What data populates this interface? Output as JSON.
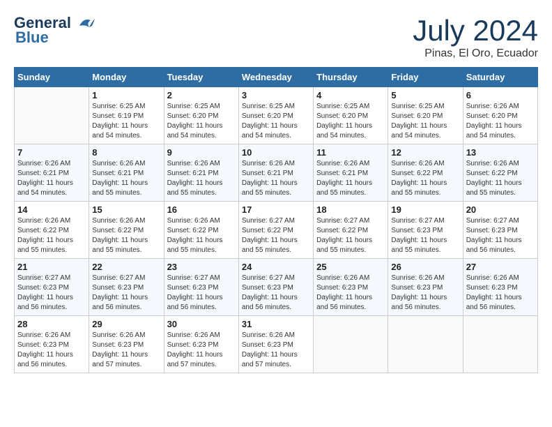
{
  "header": {
    "logo_line1": "General",
    "logo_line2": "Blue",
    "month": "July 2024",
    "location": "Pinas, El Oro, Ecuador"
  },
  "weekdays": [
    "Sunday",
    "Monday",
    "Tuesday",
    "Wednesday",
    "Thursday",
    "Friday",
    "Saturday"
  ],
  "weeks": [
    [
      {
        "day": "",
        "info": ""
      },
      {
        "day": "1",
        "info": "Sunrise: 6:25 AM\nSunset: 6:19 PM\nDaylight: 11 hours\nand 54 minutes."
      },
      {
        "day": "2",
        "info": "Sunrise: 6:25 AM\nSunset: 6:20 PM\nDaylight: 11 hours\nand 54 minutes."
      },
      {
        "day": "3",
        "info": "Sunrise: 6:25 AM\nSunset: 6:20 PM\nDaylight: 11 hours\nand 54 minutes."
      },
      {
        "day": "4",
        "info": "Sunrise: 6:25 AM\nSunset: 6:20 PM\nDaylight: 11 hours\nand 54 minutes."
      },
      {
        "day": "5",
        "info": "Sunrise: 6:25 AM\nSunset: 6:20 PM\nDaylight: 11 hours\nand 54 minutes."
      },
      {
        "day": "6",
        "info": "Sunrise: 6:26 AM\nSunset: 6:20 PM\nDaylight: 11 hours\nand 54 minutes."
      }
    ],
    [
      {
        "day": "7",
        "info": "Sunrise: 6:26 AM\nSunset: 6:21 PM\nDaylight: 11 hours\nand 54 minutes."
      },
      {
        "day": "8",
        "info": "Sunrise: 6:26 AM\nSunset: 6:21 PM\nDaylight: 11 hours\nand 55 minutes."
      },
      {
        "day": "9",
        "info": "Sunrise: 6:26 AM\nSunset: 6:21 PM\nDaylight: 11 hours\nand 55 minutes."
      },
      {
        "day": "10",
        "info": "Sunrise: 6:26 AM\nSunset: 6:21 PM\nDaylight: 11 hours\nand 55 minutes."
      },
      {
        "day": "11",
        "info": "Sunrise: 6:26 AM\nSunset: 6:21 PM\nDaylight: 11 hours\nand 55 minutes."
      },
      {
        "day": "12",
        "info": "Sunrise: 6:26 AM\nSunset: 6:22 PM\nDaylight: 11 hours\nand 55 minutes."
      },
      {
        "day": "13",
        "info": "Sunrise: 6:26 AM\nSunset: 6:22 PM\nDaylight: 11 hours\nand 55 minutes."
      }
    ],
    [
      {
        "day": "14",
        "info": "Sunrise: 6:26 AM\nSunset: 6:22 PM\nDaylight: 11 hours\nand 55 minutes."
      },
      {
        "day": "15",
        "info": "Sunrise: 6:26 AM\nSunset: 6:22 PM\nDaylight: 11 hours\nand 55 minutes."
      },
      {
        "day": "16",
        "info": "Sunrise: 6:26 AM\nSunset: 6:22 PM\nDaylight: 11 hours\nand 55 minutes."
      },
      {
        "day": "17",
        "info": "Sunrise: 6:27 AM\nSunset: 6:22 PM\nDaylight: 11 hours\nand 55 minutes."
      },
      {
        "day": "18",
        "info": "Sunrise: 6:27 AM\nSunset: 6:22 PM\nDaylight: 11 hours\nand 55 minutes."
      },
      {
        "day": "19",
        "info": "Sunrise: 6:27 AM\nSunset: 6:23 PM\nDaylight: 11 hours\nand 55 minutes."
      },
      {
        "day": "20",
        "info": "Sunrise: 6:27 AM\nSunset: 6:23 PM\nDaylight: 11 hours\nand 56 minutes."
      }
    ],
    [
      {
        "day": "21",
        "info": "Sunrise: 6:27 AM\nSunset: 6:23 PM\nDaylight: 11 hours\nand 56 minutes."
      },
      {
        "day": "22",
        "info": "Sunrise: 6:27 AM\nSunset: 6:23 PM\nDaylight: 11 hours\nand 56 minutes."
      },
      {
        "day": "23",
        "info": "Sunrise: 6:27 AM\nSunset: 6:23 PM\nDaylight: 11 hours\nand 56 minutes."
      },
      {
        "day": "24",
        "info": "Sunrise: 6:27 AM\nSunset: 6:23 PM\nDaylight: 11 hours\nand 56 minutes."
      },
      {
        "day": "25",
        "info": "Sunrise: 6:26 AM\nSunset: 6:23 PM\nDaylight: 11 hours\nand 56 minutes."
      },
      {
        "day": "26",
        "info": "Sunrise: 6:26 AM\nSunset: 6:23 PM\nDaylight: 11 hours\nand 56 minutes."
      },
      {
        "day": "27",
        "info": "Sunrise: 6:26 AM\nSunset: 6:23 PM\nDaylight: 11 hours\nand 56 minutes."
      }
    ],
    [
      {
        "day": "28",
        "info": "Sunrise: 6:26 AM\nSunset: 6:23 PM\nDaylight: 11 hours\nand 56 minutes."
      },
      {
        "day": "29",
        "info": "Sunrise: 6:26 AM\nSunset: 6:23 PM\nDaylight: 11 hours\nand 57 minutes."
      },
      {
        "day": "30",
        "info": "Sunrise: 6:26 AM\nSunset: 6:23 PM\nDaylight: 11 hours\nand 57 minutes."
      },
      {
        "day": "31",
        "info": "Sunrise: 6:26 AM\nSunset: 6:23 PM\nDaylight: 11 hours\nand 57 minutes."
      },
      {
        "day": "",
        "info": ""
      },
      {
        "day": "",
        "info": ""
      },
      {
        "day": "",
        "info": ""
      }
    ]
  ]
}
